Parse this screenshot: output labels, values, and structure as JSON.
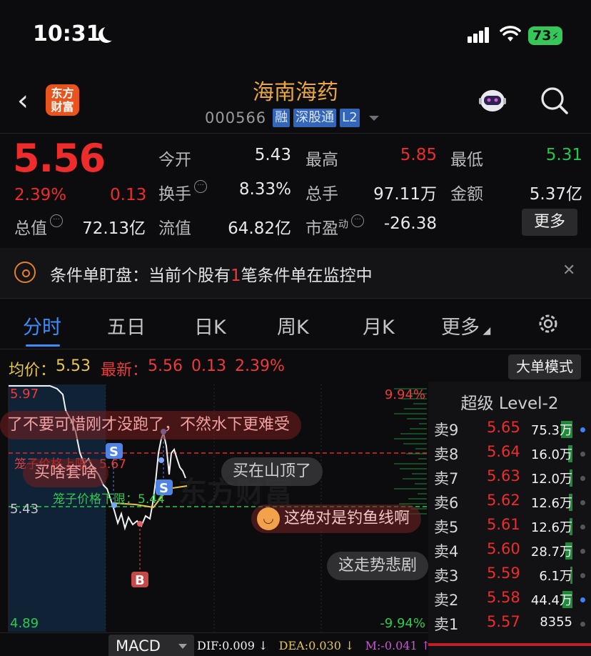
{
  "status_bar": {
    "time": "10:31",
    "battery": "73"
  },
  "header": {
    "logo_text_1": "东方",
    "logo_text_2": "财富",
    "stock_name": "海南海药",
    "stock_code": "000566",
    "tags": [
      "融",
      "深股通",
      "L2"
    ]
  },
  "quote": {
    "price": "5.56",
    "change_pct": "2.39%",
    "change_abs": "0.13",
    "fields": {
      "open_label": "今开",
      "open": "5.43",
      "high_label": "最高",
      "high": "5.85",
      "low_label": "最低",
      "low": "5.31",
      "turnover_label": "换手",
      "turnover": "8.33%",
      "volume_label": "总手",
      "volume": "97.11万",
      "amount_label": "金额",
      "amount": "5.37亿",
      "mcap_label": "总值",
      "mcap": "72.13亿",
      "float_label": "流值",
      "float": "64.82亿",
      "pe_label": "市盈",
      "pe_sup": "动",
      "pe": "-26.38"
    },
    "more_button": "更多",
    "colors": {
      "up": "#ee2c2c",
      "down": "#22c84a"
    }
  },
  "alert": {
    "prefix": "条件单盯盘：当前个股有",
    "count": "1",
    "suffix": "笔条件单在监控中"
  },
  "tabs": [
    "分时",
    "五日",
    "日K",
    "周K",
    "月K",
    "更多"
  ],
  "legend": {
    "avg_label": "均价：",
    "avg": "5.53",
    "last_label": "最新：",
    "last": "5.56",
    "chg": "0.13",
    "pct": "2.39%",
    "big_order_button": "大单模式"
  },
  "chart": {
    "y_top": "5.97",
    "y_mid": "5.43",
    "y_bottom": "4.89",
    "pct_top": "9.94%",
    "pct_bottom": "-9.94%",
    "upper_limit_label": "笼子价格上限：5.67",
    "lower_limit_label": "笼子价格下限：5.44",
    "marker_s": "S",
    "marker_b": "B",
    "watermark": "东方财富"
  },
  "danmu": [
    "了不要可惜刚才没跑了，不然水下更难受",
    "买啥套啥",
    "买在山顶了",
    "这绝对是钓鱼线啊",
    "这走势悲剧"
  ],
  "level2": {
    "title": "超级 Level-2",
    "rows": [
      {
        "label": "卖9",
        "price": "5.65",
        "vol": "75.3万"
      },
      {
        "label": "卖8",
        "price": "5.64",
        "vol": "16.0万"
      },
      {
        "label": "卖7",
        "price": "5.63",
        "vol": "12.0万"
      },
      {
        "label": "卖6",
        "price": "5.62",
        "vol": "12.6万"
      },
      {
        "label": "卖5",
        "price": "5.61",
        "vol": "12.6万"
      },
      {
        "label": "卖4",
        "price": "5.60",
        "vol": "28.7万"
      },
      {
        "label": "卖3",
        "price": "5.59",
        "vol": "6.1万"
      },
      {
        "label": "卖2",
        "price": "5.58",
        "vol": "44.4万"
      },
      {
        "label": "卖1",
        "price": "5.57",
        "vol": "8355"
      }
    ]
  },
  "indicator": {
    "name": "MACD",
    "dif": "DIF:0.009 ↓",
    "dea": "DEA:0.030 ↓",
    "m": "M:-0.041 ↑"
  }
}
